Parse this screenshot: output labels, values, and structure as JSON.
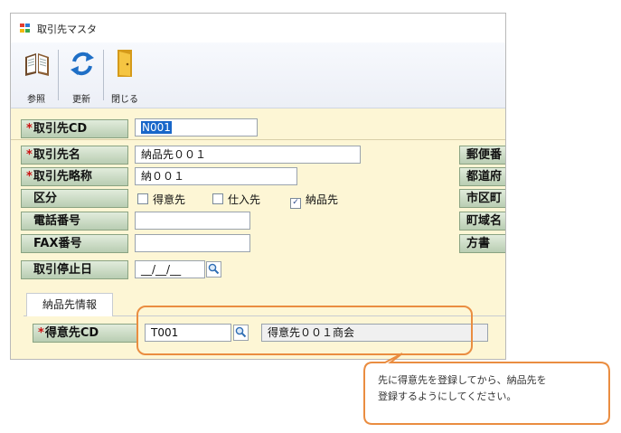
{
  "window": {
    "title": "取引先マスタ"
  },
  "toolbar": {
    "reference_label": "参照",
    "refresh_label": "更新",
    "close_label": "閉じる"
  },
  "header": {
    "code_label": "取引先CD",
    "code_value": "N001"
  },
  "form": {
    "name_label": "取引先名",
    "name_value": "納品先００１",
    "short_name_label": "取引先略称",
    "short_name_value": "納００１",
    "category_label": "区分",
    "category_options": [
      {
        "label": "得意先",
        "checked": false
      },
      {
        "label": "仕入先",
        "checked": false
      },
      {
        "label": "納品先",
        "checked": true
      }
    ],
    "phone_label": "電話番号",
    "phone_value": "",
    "fax_label": "FAX番号",
    "fax_value": "",
    "stop_date_label": "取引停止日",
    "stop_date_value": "__/__/__",
    "right_labels": [
      "郵便番",
      "都道府",
      "市区町",
      "町域名",
      "方書"
    ]
  },
  "tab": {
    "label": "納品先情報"
  },
  "delivery": {
    "customer_cd_label": "得意先CD",
    "customer_cd_value": "T001",
    "customer_name_value": "得意先００１商会"
  },
  "callout": {
    "line1": "先に得意先を登録してから、納品先を",
    "line2": "登録するようにしてください。"
  },
  "colors": {
    "panel": "#fdf6d5",
    "label_bg": "#c9dac2",
    "accent": "#ea8d41",
    "required": "#cc1111",
    "selection": "#1866c9"
  }
}
